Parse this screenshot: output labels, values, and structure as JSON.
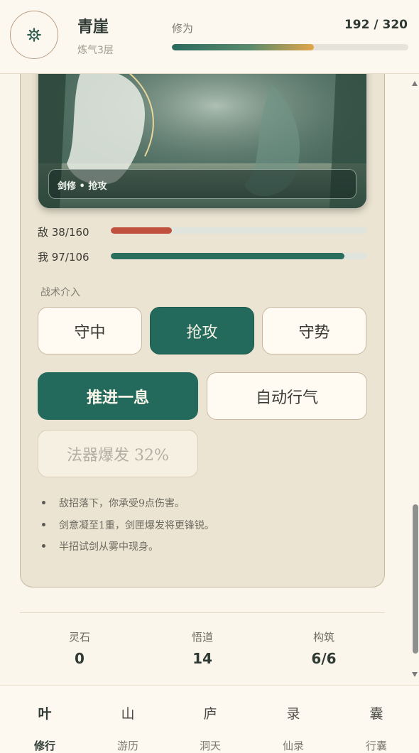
{
  "header": {
    "name": "青崖",
    "realm": "炼气3层",
    "cultivation_label": "修为",
    "cultivation_value": "192 / 320",
    "cultivation_progress": 0.6
  },
  "scene": {
    "caption": "剑修 • 抢攻"
  },
  "hp": {
    "enemy_label": "敌 38/160",
    "enemy_ratio": 0.2375,
    "self_label": "我 97/106",
    "self_ratio": 0.915
  },
  "tactics": {
    "title": "战术介入",
    "options": [
      "守中",
      "抢攻",
      "守势"
    ],
    "active_index": 1
  },
  "actions": {
    "advance": "推进一息",
    "auto": "自动行气",
    "burst": "法器爆发 32%"
  },
  "log": [
    "敌招落下，你承受9点伤害。",
    "剑意凝至1重，剑匣爆发将更锋锐。",
    "半招试剑从雾中现身。"
  ],
  "stats": [
    {
      "label": "灵石",
      "value": "0"
    },
    {
      "label": "悟道",
      "value": "14"
    },
    {
      "label": "构筑",
      "value": "6/6"
    }
  ],
  "nav": [
    {
      "glyph": "叶",
      "label": "修行"
    },
    {
      "glyph": "山",
      "label": "游历"
    },
    {
      "glyph": "庐",
      "label": "洞天"
    },
    {
      "glyph": "录",
      "label": "仙录"
    },
    {
      "glyph": "囊",
      "label": "行囊"
    }
  ],
  "nav_active": 0,
  "colors": {
    "accent": "#236a5c",
    "enemy_hp": "#c0513f",
    "self_hp": "#2a6f5e",
    "gold": "#e2a64a"
  },
  "icons": {
    "settings": "gear-icon"
  }
}
